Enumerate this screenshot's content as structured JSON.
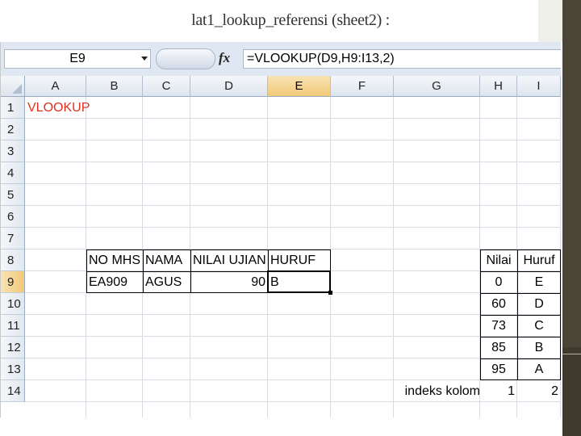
{
  "title": "lat1_lookup_referensi (sheet2) :",
  "formula_bar": {
    "name_box": "E9",
    "fx_label": "fx",
    "formula": "=VLOOKUP(D9,H9:I13,2)"
  },
  "columns": [
    "A",
    "B",
    "C",
    "D",
    "E",
    "F",
    "G",
    "H",
    "I"
  ],
  "rows": [
    "1",
    "2",
    "3",
    "4",
    "5",
    "6",
    "7",
    "8",
    "9",
    "10",
    "11",
    "12",
    "13",
    "14"
  ],
  "cells": {
    "A1": "VLOOKUP",
    "B8": "NO MHS",
    "C8": "NAMA",
    "D8": "NILAI UJIAN",
    "E8": "HURUF",
    "B9": "EA909",
    "C9": "AGUS",
    "D9": "90",
    "E9": "B",
    "H8": "Nilai",
    "I8": "Huruf",
    "H9": "0",
    "I9": "E",
    "H10": "60",
    "I10": "D",
    "H11": "73",
    "I11": "C",
    "H12": "85",
    "I12": "B",
    "H13": "95",
    "I13": "A",
    "G14": "indeks kolom",
    "H14": "1",
    "I14": "2"
  },
  "colors": {
    "accent_red": "#e03020",
    "selected_header": "#f2c978"
  }
}
